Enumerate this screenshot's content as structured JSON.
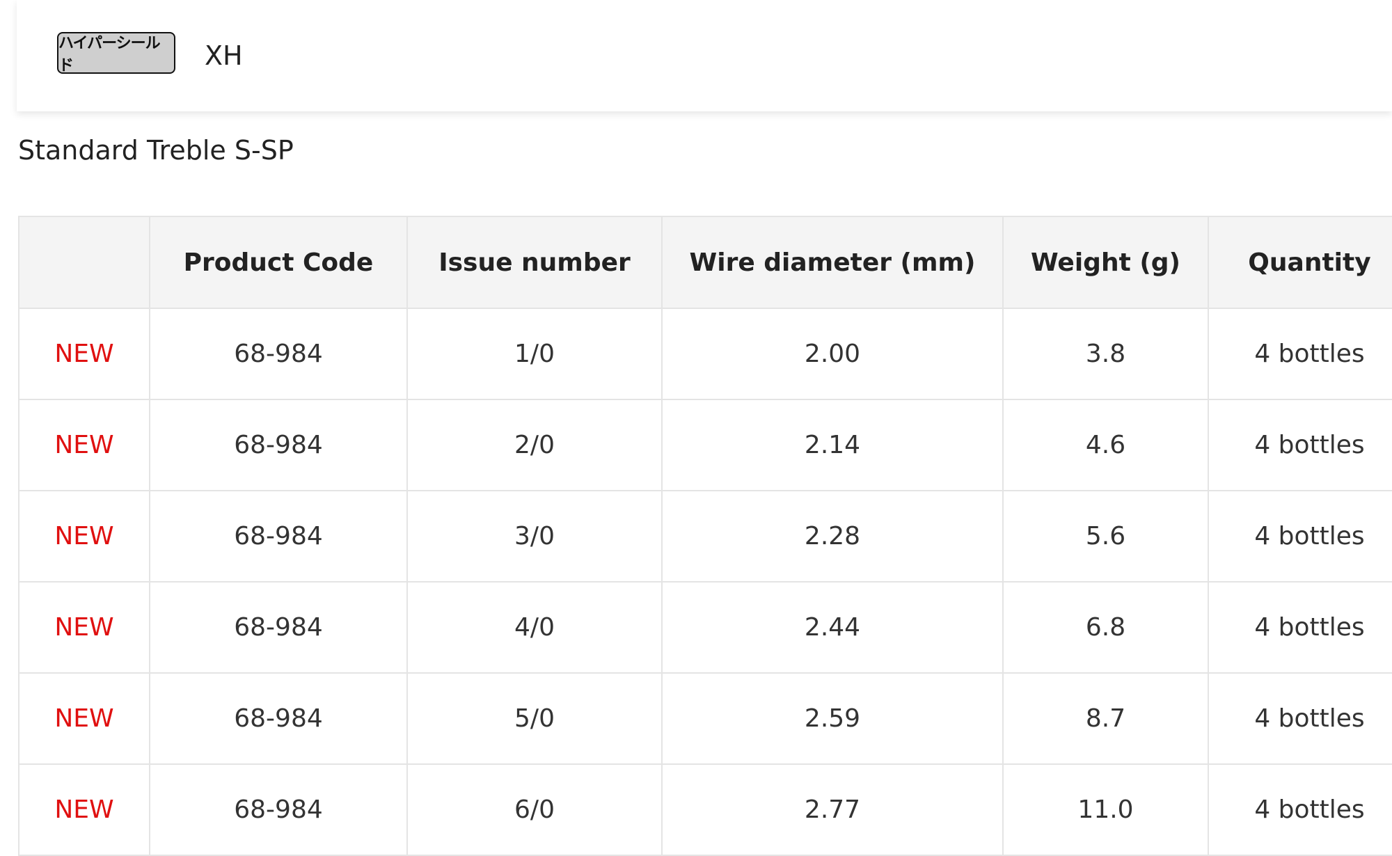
{
  "header": {
    "badge_label": "ハイパーシールド",
    "series": "XH"
  },
  "product_title": "Standard Treble S-SP",
  "table": {
    "columns": [
      "",
      "Product Code",
      "Issue number",
      "Wire diameter (mm)",
      "Weight (g)",
      "Quantity"
    ],
    "rows": [
      {
        "tag": "NEW",
        "code": "68-984",
        "issue": "1/0",
        "wire": "2.00",
        "weight": "3.8",
        "quantity": "4 bottles"
      },
      {
        "tag": "NEW",
        "code": "68-984",
        "issue": "2/0",
        "wire": "2.14",
        "weight": "4.6",
        "quantity": "4 bottles"
      },
      {
        "tag": "NEW",
        "code": "68-984",
        "issue": "3/0",
        "wire": "2.28",
        "weight": "5.6",
        "quantity": "4 bottles"
      },
      {
        "tag": "NEW",
        "code": "68-984",
        "issue": "4/0",
        "wire": "2.44",
        "weight": "6.8",
        "quantity": "4 bottles"
      },
      {
        "tag": "NEW",
        "code": "68-984",
        "issue": "5/0",
        "wire": "2.59",
        "weight": "8.7",
        "quantity": "4 bottles"
      },
      {
        "tag": "NEW",
        "code": "68-984",
        "issue": "6/0",
        "wire": "2.77",
        "weight": "11.0",
        "quantity": "4 bottles"
      }
    ]
  },
  "colors": {
    "new_tag": "#e01010",
    "header_bg": "#f4f4f4",
    "border": "#e4e4e4",
    "badge_bg": "#cfcfcf"
  }
}
